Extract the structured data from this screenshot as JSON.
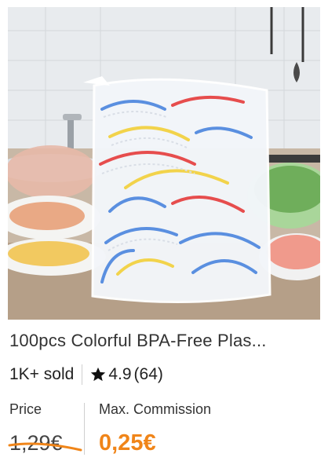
{
  "product": {
    "image_alt": "Bag of colorful disposable plastic food covers on a kitchen counter",
    "title": "100pcs Colorful BPA-Free Plas...",
    "sold": "1K+ sold",
    "rating": "4.9",
    "reviews": "(64)"
  },
  "pricing": {
    "price_label": "Price",
    "price_value": "1,29€",
    "commission_label": "Max. Commission",
    "commission_value": "0,25€"
  },
  "colors": {
    "accent": "#f08519",
    "text": "#222222",
    "divider": "#cfcfcf"
  },
  "icons": {
    "rating": "star-icon"
  }
}
